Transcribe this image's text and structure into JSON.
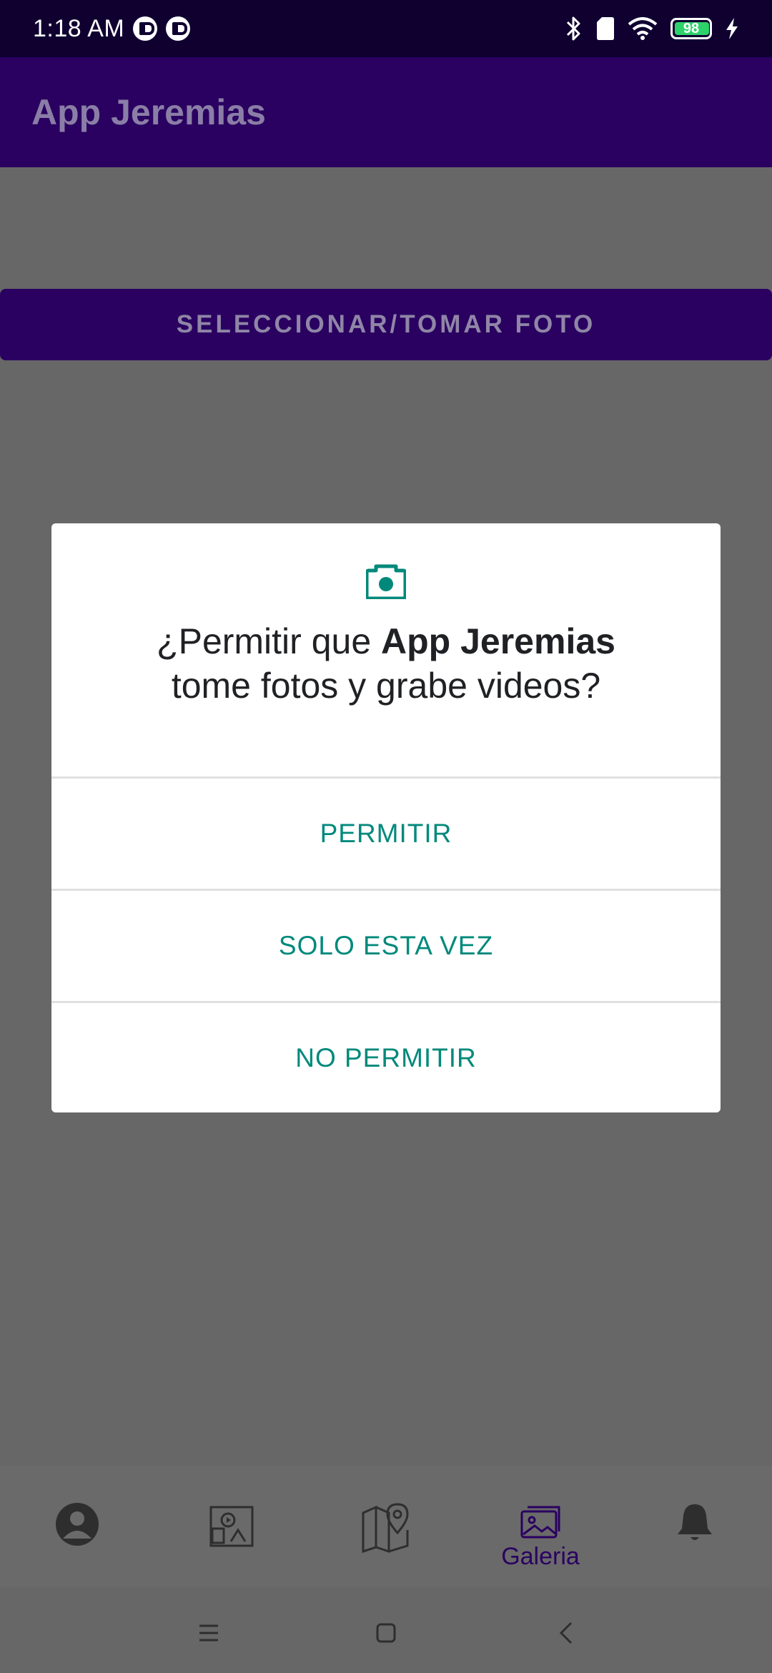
{
  "status_bar": {
    "time": "1:18 AM",
    "battery": "98"
  },
  "toolbar": {
    "title": "App Jeremias"
  },
  "main": {
    "button_label": "SELECCIONAR/TOMAR FOTO"
  },
  "dialog": {
    "icon": "camera-icon",
    "title_prefix": "¿Permitir que ",
    "title_app": "App Jeremias",
    "title_suffix": "tome fotos y grabe videos?",
    "actions": [
      "PERMITIR",
      "SOLO ESTA VEZ",
      "NO PERMITIR"
    ],
    "accent_color": "#00897b"
  },
  "bottom_nav": {
    "items": [
      {
        "icon": "profile-icon"
      },
      {
        "icon": "media-icon"
      },
      {
        "icon": "map-pin-icon"
      },
      {
        "icon": "gallery-icon",
        "label": "Galeria",
        "selected": true
      },
      {
        "icon": "bell-icon"
      }
    ]
  },
  "colors": {
    "status_bar": "#0f0030",
    "app_bar": "#2a0061",
    "scrim": "#676767"
  }
}
